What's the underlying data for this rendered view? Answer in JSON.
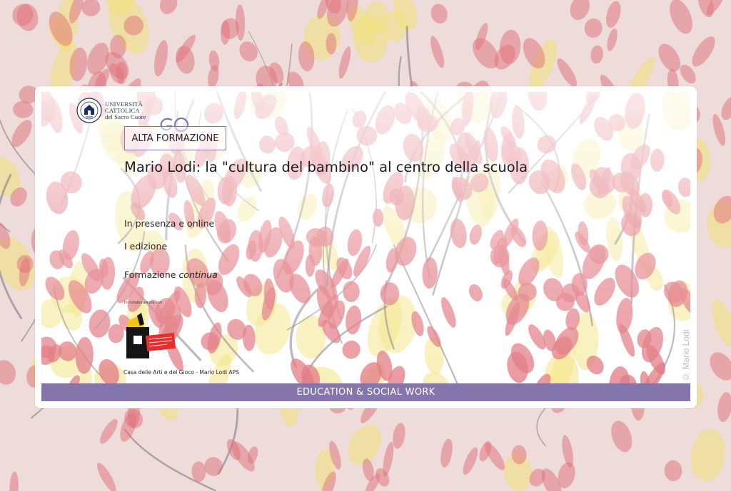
{
  "university": {
    "line1": "Università",
    "line2": "Cattolica",
    "line3": "del Sacro Cuore"
  },
  "badge_label": "ALTA FORMAZIONE",
  "course_title": "Mario Lodi: la \"cultura del bambino\" al centro della scuola",
  "details": {
    "mode": "In presenza e online",
    "edition": "I edizione",
    "type_prefix": "Formazione",
    "type_emphasis": "continua"
  },
  "collaboration_label": "In collaborazione con",
  "partner_name": "Casa delle Arti e del Gioco - Mario Lodi APS",
  "image_credit": "© Mario Lodi",
  "category_band": "EDUCATION & SOCIAL WORK",
  "colors": {
    "accent_purple": "#8475ad",
    "university_blue": "#1f2f5e",
    "stroke_red": "#e0707a",
    "stroke_yellow": "#f3e27a",
    "branch_gray": "#7a6f7e",
    "partner_yellow": "#f2c318",
    "partner_red": "#e52f2f"
  },
  "icons": {
    "university_seal": "university-seal-icon",
    "go_mark": "go-mark-icon",
    "partner_logo": "partner-logo-icon"
  }
}
